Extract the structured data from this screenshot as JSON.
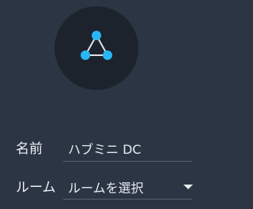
{
  "hub": {
    "icon": "triangle-network-icon",
    "accent": "#29b6f6"
  },
  "fields": {
    "name": {
      "label": "名前",
      "value": "ハブミニ DC"
    },
    "room": {
      "label": "ルーム",
      "placeholder": "ルームを選択"
    }
  }
}
